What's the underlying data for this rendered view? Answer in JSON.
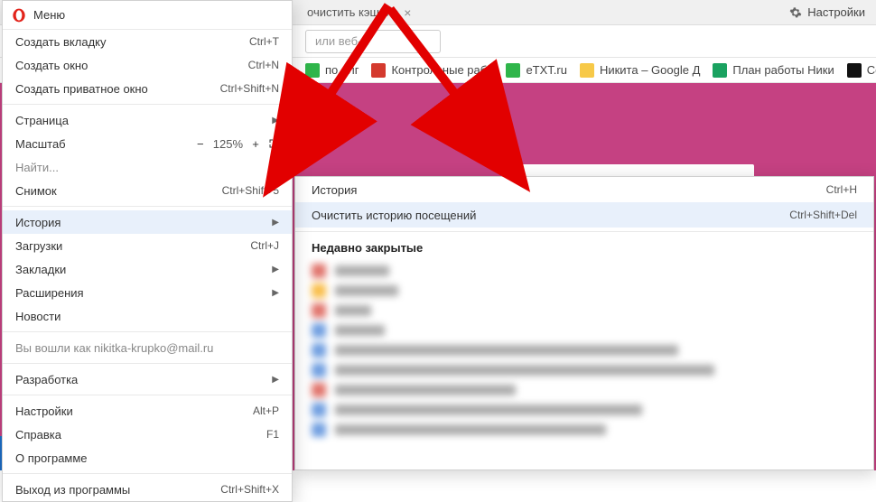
{
  "tab": {
    "title": "очистить кэш в о"
  },
  "top": {
    "settings_label": "Настройки"
  },
  "addressbar": {
    "placeholder": "или веб-а"
  },
  "bookmarks": {
    "items": [
      {
        "label": "по алг",
        "color": "#2fb54a"
      },
      {
        "label": "Контрольные рабо",
        "color": "#d43a2e"
      },
      {
        "label": "eTXT.ru",
        "color": "#2fb54a"
      },
      {
        "label": "Никита – Google Д",
        "color": "#f7c948"
      },
      {
        "label": "План работы Ники",
        "color": "#1aa260"
      },
      {
        "label": "Се",
        "color": "#111"
      }
    ]
  },
  "menu": {
    "header": "Меню",
    "items": [
      {
        "label": "Создать вкладку",
        "shortcut": "Ctrl+T"
      },
      {
        "label": "Создать окно",
        "shortcut": "Ctrl+N"
      },
      {
        "label": "Создать приватное окно",
        "shortcut": "Ctrl+Shift+N"
      }
    ],
    "page": {
      "label": "Страница"
    },
    "zoom": {
      "label": "Масштаб",
      "value": "125%"
    },
    "find": {
      "label": "Найти..."
    },
    "snapshot": {
      "label": "Снимок",
      "shortcut": "Ctrl+Shift+5"
    },
    "history": {
      "label": "История"
    },
    "downloads": {
      "label": "Загрузки",
      "shortcut": "Ctrl+J"
    },
    "bookmarks_row": {
      "label": "Закладки"
    },
    "extensions": {
      "label": "Расширения"
    },
    "news": {
      "label": "Новости"
    },
    "logged_in": "Вы вошли как nikitka-krupko@mail.ru",
    "dev": {
      "label": "Разработка"
    },
    "settings": {
      "label": "Настройки",
      "shortcut": "Alt+P"
    },
    "help": {
      "label": "Справка",
      "shortcut": "F1"
    },
    "about": {
      "label": "О программе"
    },
    "exit": {
      "label": "Выход из программы",
      "shortcut": "Ctrl+Shift+X"
    }
  },
  "submenu": {
    "history": {
      "label": "История",
      "shortcut": "Ctrl+H"
    },
    "clear": {
      "label": "Очистить историю посещений",
      "shortcut": "Ctrl+Shift+Del"
    },
    "recent": "Недавно закрытые"
  }
}
